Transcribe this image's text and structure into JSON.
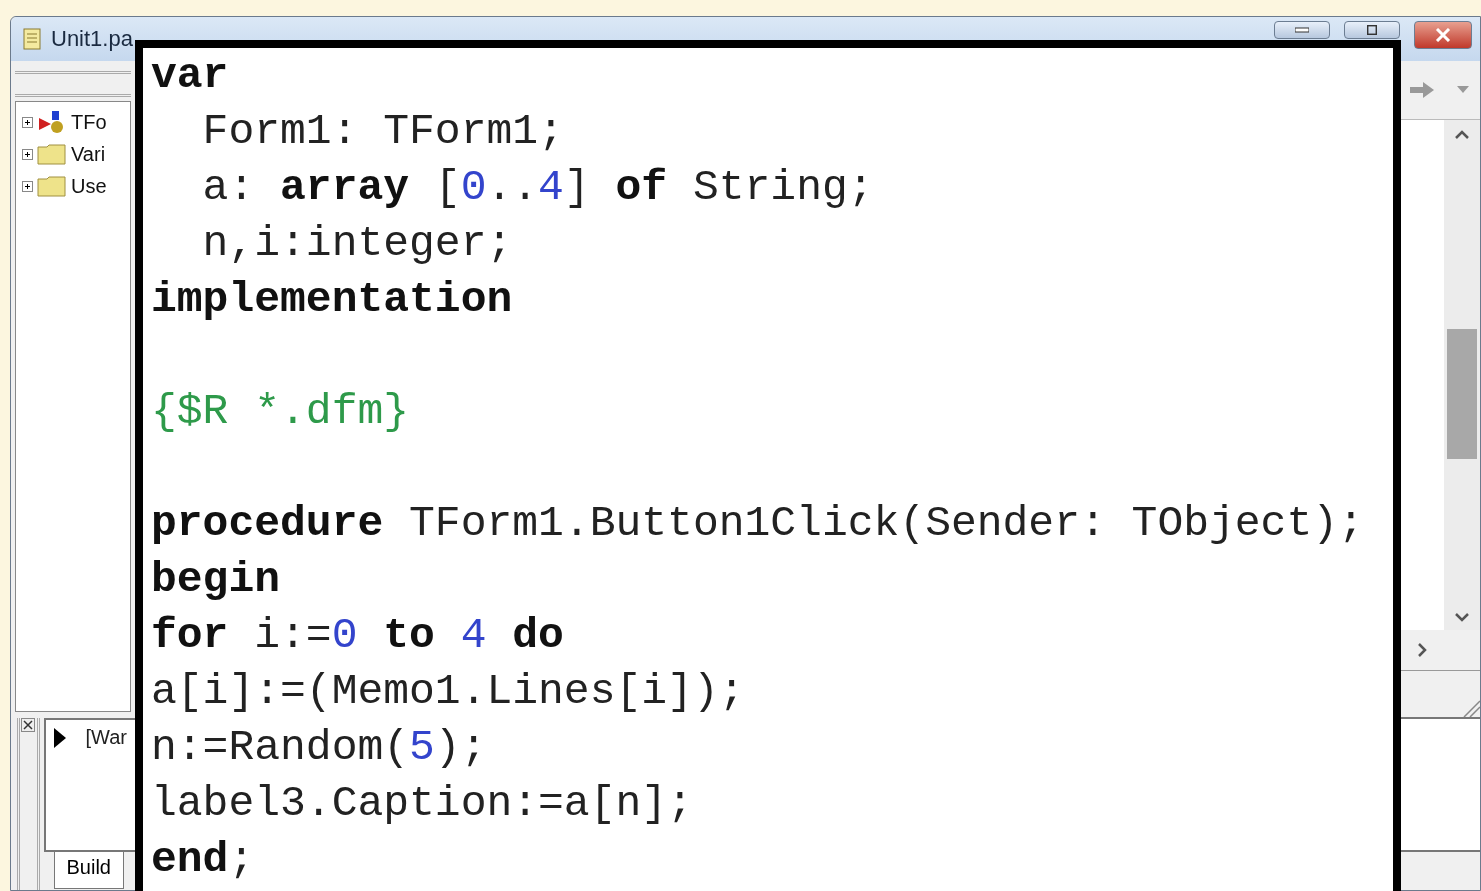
{
  "window": {
    "title": "Unit1.pa"
  },
  "structure_tree": [
    {
      "label": "TFo",
      "kind": "components",
      "expanded": false
    },
    {
      "label": "Vari",
      "kind": "folder",
      "expanded": false
    },
    {
      "label": "Use",
      "kind": "folder",
      "expanded": false
    }
  ],
  "messages": [
    {
      "text": "[War"
    }
  ],
  "message_tabs": [
    {
      "label": "Build",
      "selected": true
    }
  ],
  "code_lines": [
    {
      "kind": "code",
      "tokens": [
        {
          "kind": "keyword",
          "text": "var"
        }
      ]
    },
    {
      "kind": "code",
      "tokens": [
        {
          "kind": "plain",
          "text": "  Form1: TForm1;"
        }
      ]
    },
    {
      "kind": "code",
      "tokens": [
        {
          "kind": "plain",
          "text": "  a: "
        },
        {
          "kind": "keyword",
          "text": "array"
        },
        {
          "kind": "plain",
          "text": " ["
        },
        {
          "kind": "number",
          "text": "0"
        },
        {
          "kind": "plain",
          "text": ".."
        },
        {
          "kind": "number",
          "text": "4"
        },
        {
          "kind": "plain",
          "text": "] "
        },
        {
          "kind": "keyword",
          "text": "of"
        },
        {
          "kind": "plain",
          "text": " String;"
        }
      ]
    },
    {
      "kind": "code",
      "tokens": [
        {
          "kind": "plain",
          "text": "  n,i:integer;"
        }
      ]
    },
    {
      "kind": "code",
      "tokens": [
        {
          "kind": "keyword",
          "text": "implementation"
        }
      ]
    },
    {
      "kind": "blank"
    },
    {
      "kind": "code",
      "tokens": [
        {
          "kind": "comment",
          "text": "{$R *.dfm}"
        }
      ]
    },
    {
      "kind": "blank"
    },
    {
      "kind": "code",
      "tokens": [
        {
          "kind": "keyword",
          "text": "procedure"
        },
        {
          "kind": "plain",
          "text": " TForm1.Button1Click(Sender: TObject);"
        }
      ]
    },
    {
      "kind": "code",
      "tokens": [
        {
          "kind": "keyword",
          "text": "begin"
        }
      ]
    },
    {
      "kind": "code",
      "tokens": [
        {
          "kind": "keyword",
          "text": "for"
        },
        {
          "kind": "plain",
          "text": " i:="
        },
        {
          "kind": "number",
          "text": "0"
        },
        {
          "kind": "keyword",
          "text": " to "
        },
        {
          "kind": "number",
          "text": "4"
        },
        {
          "kind": "keyword",
          "text": " do"
        }
      ]
    },
    {
      "kind": "code",
      "tokens": [
        {
          "kind": "plain",
          "text": "a[i]:=(Memo1.Lines[i]);"
        }
      ]
    },
    {
      "kind": "code",
      "tokens": [
        {
          "kind": "plain",
          "text": "n:=Random("
        },
        {
          "kind": "number",
          "text": "5"
        },
        {
          "kind": "plain",
          "text": ");"
        }
      ]
    },
    {
      "kind": "code",
      "tokens": [
        {
          "kind": "plain",
          "text": "label3.Caption:=a[n];"
        }
      ]
    },
    {
      "kind": "code",
      "tokens": [
        {
          "kind": "keyword",
          "text": "end"
        },
        {
          "kind": "plain",
          "text": ";"
        }
      ]
    }
  ]
}
